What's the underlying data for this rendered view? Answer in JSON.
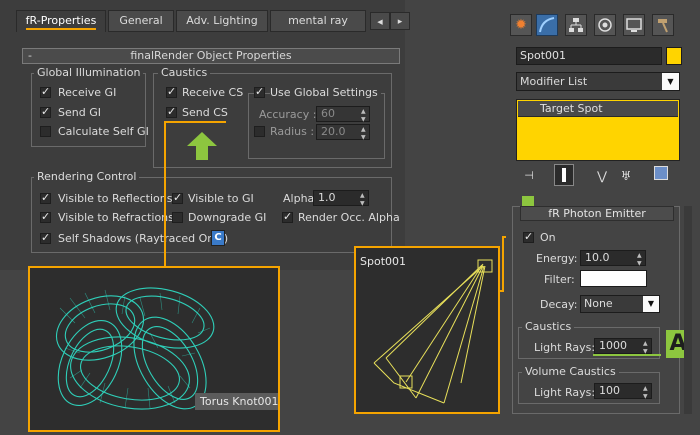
{
  "tabs": [
    {
      "label": "fR-Properties"
    },
    {
      "label": "General"
    },
    {
      "label": "Adv. Lighting"
    },
    {
      "label": "mental ray"
    }
  ],
  "nav_arrows": {
    "left": "◀",
    "right": "▸"
  },
  "rollout": {
    "collapse": "-",
    "title": "finalRender Object Properties"
  },
  "global_illumination": {
    "title": "Global Illumination",
    "receive_gi": "Receive GI",
    "send_gi": "Send GI",
    "calc_self_gi": "Calculate Self GI"
  },
  "caustics": {
    "title": "Caustics",
    "receive_cs": "Receive CS",
    "send_cs": "Send CS",
    "use_global": "Use Global Settings",
    "accuracy_label": "Accuracy :",
    "accuracy_value": "60",
    "radius_label": "Radius :",
    "radius_value": "20.0"
  },
  "rendering_control": {
    "title": "Rendering Control",
    "visible_reflections": "Visible to Reflections",
    "visible_refractions": "Visible to Refractions",
    "self_shadows": "Self Shadows (Raytraced Only)",
    "self_shadows_btn": "C",
    "visible_gi": "Visible to GI",
    "downgrade_gi": "Downgrade GI",
    "alpha_label": "Alpha",
    "alpha_value": "1.0",
    "render_occ_alpha": "Render Occ. Alpha"
  },
  "viewport_torus": {
    "label": "Torus Knot001"
  },
  "viewport_spot": {
    "label": "Spot001"
  },
  "modify_panel": {
    "object_name": "Spot001",
    "object_color": "#ffd400",
    "modifier_list": "Modifier List",
    "stack_item": "Target Spot"
  },
  "photon_emitter": {
    "title": "fR Photon Emitter",
    "on_label": "On",
    "energy_label": "Energy:",
    "energy_value": "10.0",
    "filter_label": "Filter:",
    "filter_color": "#ffffff",
    "decay_label": "Decay:",
    "decay_value": "None",
    "caustics_title": "Caustics",
    "caustics_light_rays_label": "Light Rays:",
    "caustics_light_rays_value": "1000",
    "volume_title": "Volume Caustics",
    "volume_light_rays_label": "Light Rays:",
    "volume_light_rays_value": "100"
  },
  "marker": {
    "letter": "A"
  },
  "colors": {
    "accent_orange": "#f5a400",
    "arrow_green": "#8dc63f",
    "wire_cyan": "#2fe0c8",
    "spot_yellow": "#e8e05a"
  }
}
